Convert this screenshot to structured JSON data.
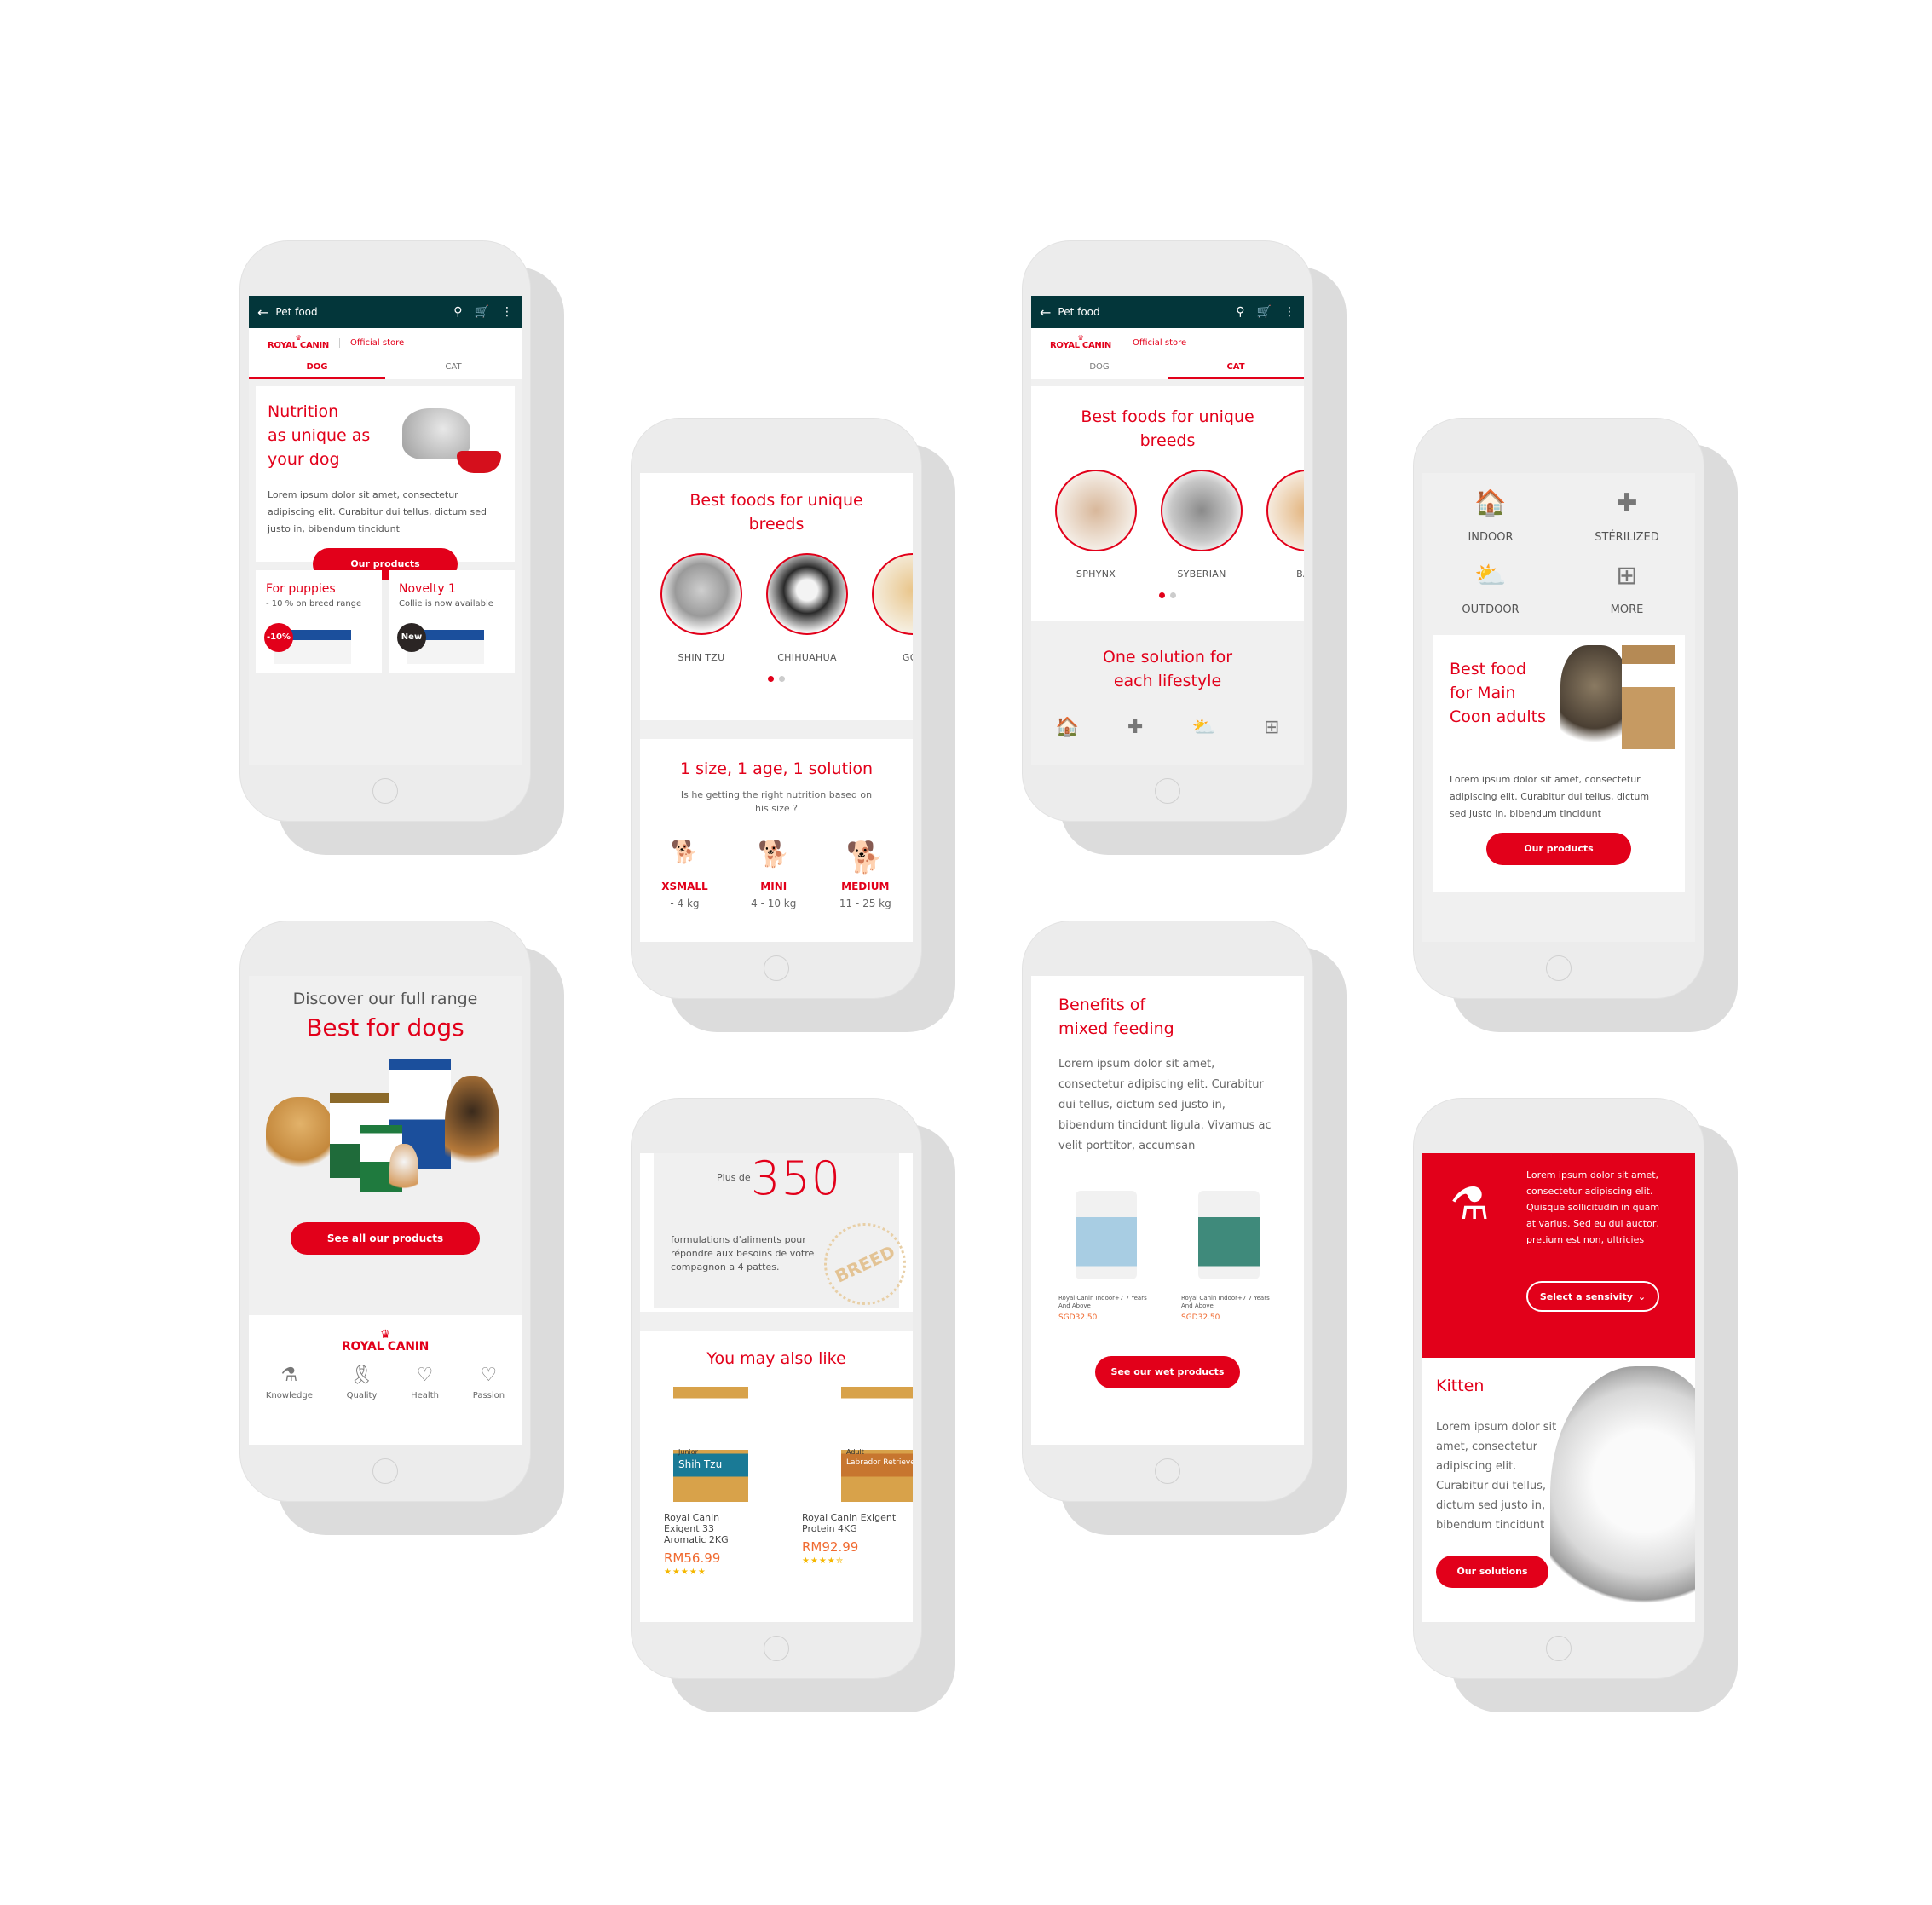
{
  "shared": {
    "appbar_title": "Pet food",
    "brand_name": "ROYAL CANIN",
    "brand_store": "Official store",
    "tab_dog": "DOG",
    "tab_cat": "CAT"
  },
  "phone1": {
    "hero_title_lines": [
      "Nutrition",
      "as unique as",
      "your dog"
    ],
    "hero_text": "Lorem ipsum dolor sit amet, consectetur adipiscing elit. Curabitur dui tellus, dictum sed justo in, bibendum tincidunt",
    "hero_button": "Our products",
    "promos": [
      {
        "title": "For puppies",
        "subtitle": "- 10 % on breed range",
        "badge": "-10%"
      },
      {
        "title": "Novelty 1",
        "subtitle": "Collie is now available",
        "badge": "New"
      }
    ]
  },
  "phone2": {
    "breeds_title": "Best foods for unique breeds",
    "breeds": [
      "SHIN TZU",
      "CHIHUAHUA",
      "GOL"
    ],
    "size_title": "1 size, 1 age, 1 solution",
    "size_subtitle": "Is he getting the right nutrition based on his size ?",
    "sizes": [
      {
        "label": "XSMALL",
        "range": "- 4 kg"
      },
      {
        "label": "MINI",
        "range": "4 - 10 kg"
      },
      {
        "label": "MEDIUM",
        "range": "11 - 25 kg"
      }
    ]
  },
  "phone3": {
    "breeds_title": "Best foods for unique breeds",
    "breeds": [
      "SPHYNX",
      "SYBERIAN",
      "BALI"
    ],
    "lifestyle_title": "One solution for each lifestyle"
  },
  "phone4": {
    "lifestyles": [
      "INDOOR",
      "STÉRILIZED",
      "OUTDOOR",
      "MORE"
    ],
    "card_title_lines": [
      "Best food",
      "for Main",
      "Coon adults"
    ],
    "card_text": "Lorem ipsum dolor sit amet, consectetur adipiscing elit. Curabitur dui tellus, dictum sed justo in, bibendum tincidunt",
    "card_button": "Our products"
  },
  "phone5": {
    "pre_title": "Discover our full range",
    "title": "Best for dogs",
    "button": "See all our products",
    "values": [
      "Knowledge",
      "Quality",
      "Health",
      "Passion"
    ]
  },
  "phone6": {
    "plus_de": "Plus de",
    "count": "350",
    "formulations_text": "formulations d'aliments pour répondre aux besoins de votre compagnon a 4 pattes.",
    "stamp_text": "BREED",
    "also_like_title": "You may also like",
    "products": [
      {
        "name": "Royal Canin Exigent 33 Aromatic 2KG",
        "price": "RM56.99",
        "pack_label": "Shih Tzu",
        "pack_sub": "Junior",
        "rating": 5
      },
      {
        "name": "Royal Canin Exigent Protein 4KG",
        "price": "RM92.99",
        "pack_label": "Labrador Retriever",
        "pack_sub": "Adult",
        "rating": 4.5
      }
    ]
  },
  "phone7": {
    "title_lines": [
      "Benefits of",
      "mixed feeding"
    ],
    "text": "Lorem ipsum dolor sit amet, consectetur adipiscing elit. Curabitur dui tellus, dictum sed justo in, bibendum tincidunt ligula. Vivamus ac velit porttitor, accumsan",
    "products": [
      {
        "name": "Royal Canin Indoor+7 7 Years And Above",
        "price": "SGD32.50"
      },
      {
        "name": "Royal Canin Indoor+7 7 Years And Above",
        "price": "SGD32.50"
      }
    ],
    "button": "See our wet products"
  },
  "phone8": {
    "red_text": "Lorem ipsum dolor sit amet, consectetur adipiscing elit. Quisque sollicitudin in quam at varius. Sed eu dui auctor, pretium est non, ultricies",
    "select_label": "Select a sensivity",
    "kitten_title": "Kitten",
    "kitten_text": "Lorem ipsum dolor sit amet, consectetur adipiscing elit. Curabitur dui tellus, dictum sed justo in, bibendum tincidunt",
    "button": "Our solutions"
  },
  "colors": {
    "brand_red": "#e2001a",
    "appbar": "#03363a",
    "price_orange": "#f06a30",
    "star": "#f5b700"
  }
}
